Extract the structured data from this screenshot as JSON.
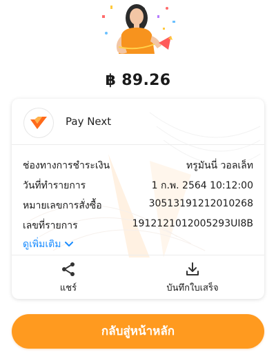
{
  "receipt": {
    "currency_symbol": "฿",
    "amount": "89.26"
  },
  "merchant": {
    "name": "Pay Next",
    "logo_icon": "pay-next-logo"
  },
  "details": [
    {
      "label": "ช่องทางการชำระเงิน",
      "value": "ทรูมันนี่ วอลเล็ท"
    },
    {
      "label": "วันที่ทำรายการ",
      "value": "1 ก.พ. 2564  10:12:00"
    },
    {
      "label": "หมายเลขการสั่งซื้อ",
      "value": "30513191212010268"
    },
    {
      "label": "เลขที่รายการ",
      "value": "1912121012005293UI8B"
    }
  ],
  "see_more_label": "ดูเพิ่มเติม",
  "actions": {
    "share_label": "แชร์",
    "save_label": "บันทึกใบเสร็จ"
  },
  "home_button_label": "กลับสู่หน้าหลัก",
  "colors": {
    "accent": "#ff9a1f",
    "link": "#1a8cff"
  }
}
